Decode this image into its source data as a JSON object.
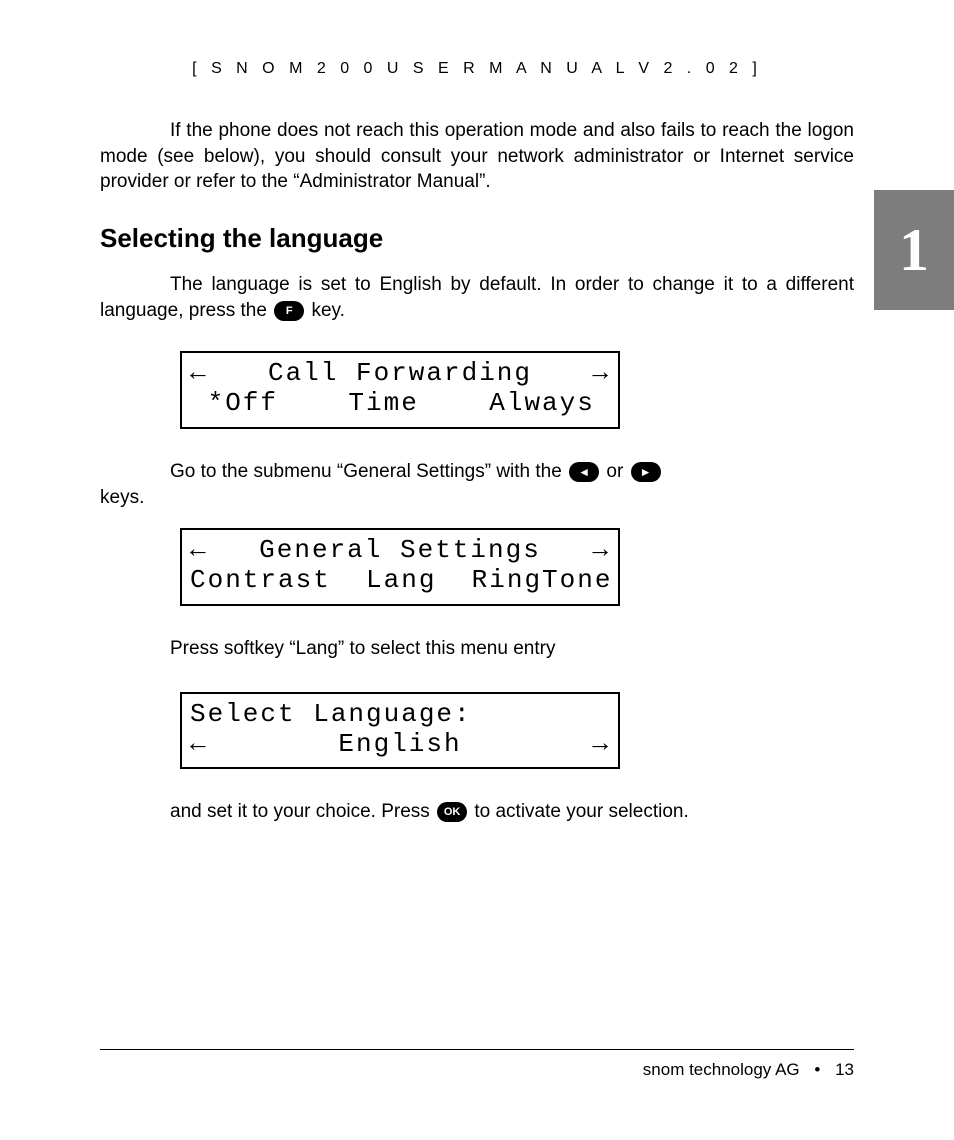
{
  "header": "[  S N O M  2 0 0  U S E R  M A N U A L  V 2 . 0 2  ]",
  "chapter_number": "1",
  "intro_paragraph": "If the phone does not reach this operation mode and also fails to reach the logon mode (see below), you should consult your network administrator or Internet service provider or refer to the “Administrator Manual”.",
  "section_heading": "Selecting the language",
  "lang_para_1a": "The language is set to English by default. In order to change it to a different language, press the ",
  "lang_para_1b": " key.",
  "key_f": "F",
  "lcd1": {
    "line1_left": "←",
    "line1_mid": "Call Forwarding",
    "line1_right": "→",
    "line2": " *Off    Time    Always"
  },
  "submenu_a": "Go  to  the  submenu  “General  Settings”  with  the  ",
  "submenu_b": " or ",
  "submenu_c": " keys.",
  "key_left": "◄",
  "key_right": "►",
  "lcd2": {
    "line1_left": "←",
    "line1_mid": "General Settings",
    "line1_right": "→",
    "line2": "Contrast  Lang  RingTone"
  },
  "press_softkey": "Press softkey “Lang” to select this menu entry",
  "lcd3": {
    "line1": "Select Language:",
    "line2_left": "←",
    "line2_mid": "English",
    "line2_right": "→"
  },
  "activate_a": "and set it to your choice. Press ",
  "activate_b": " to activate your selection.",
  "key_ok": "OK",
  "footer_company": "snom technology AG",
  "footer_bullet": "•",
  "footer_page": "13"
}
